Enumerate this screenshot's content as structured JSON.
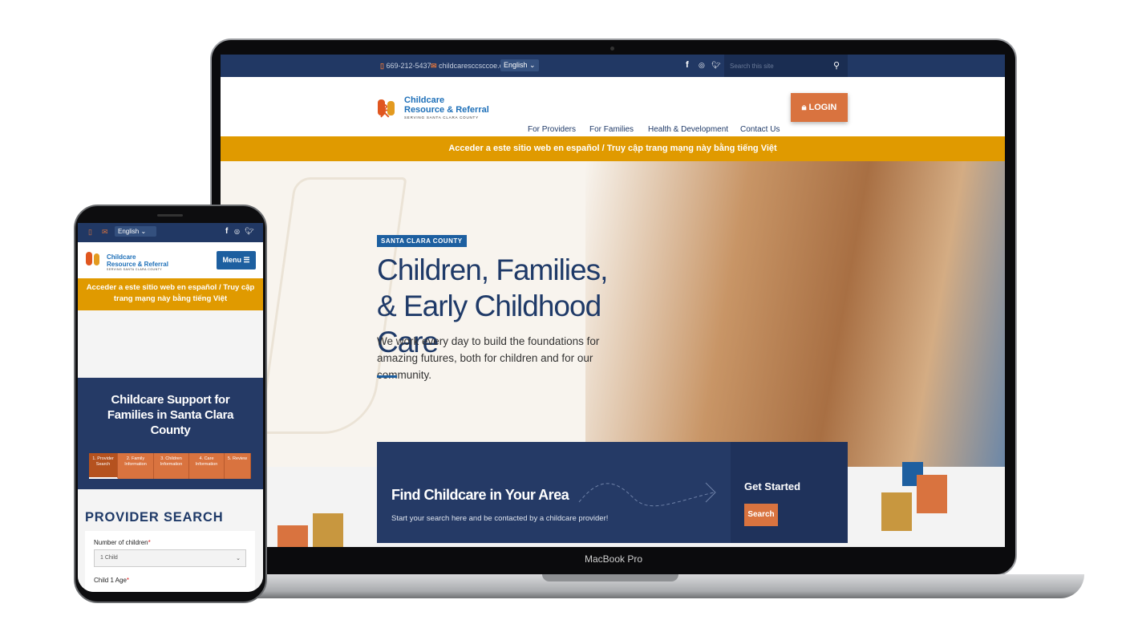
{
  "device_label": "MacBook Pro",
  "site": {
    "topbar": {
      "phone": "669-212-5437",
      "email": "childcaresccsccoe.org",
      "language": "English",
      "search_placeholder": "Search this site",
      "social": [
        "facebook-icon",
        "instagram-icon",
        "twitter-icon"
      ]
    },
    "logo": {
      "line1": "Childcare",
      "line2": "Resource & Referral",
      "tagline": "SERVING SANTA CLARA COUNTY"
    },
    "nav": [
      "For Providers",
      "For Families",
      "Health & Development",
      "Contact Us"
    ],
    "login_label": "LOGIN",
    "language_banner": "Acceder a este sitio web en español / Truy cập trang mạng này bằng tiếng Việt",
    "hero": {
      "badge": "SANTA CLARA COUNTY",
      "title": "Children, Families, & Early Childhood Care",
      "text": "We work every day to build the foundations for amazing futures, both for children and for our community."
    },
    "find": {
      "title": "Find Childcare in Your Area",
      "text": "Start your search here and be contacted by a childcare provider!",
      "cta_title": "Get Started",
      "button": "Search"
    }
  },
  "mobile": {
    "language": "English",
    "menu_label": "Menu",
    "title": "Childcare Support for Families in Santa Clara County",
    "steps": [
      "1. Provider Search",
      "2. Family Information",
      "3. Children Information",
      "4. Care Information",
      "5. Review"
    ],
    "active_step": 1,
    "section_title": "PROVIDER SEARCH",
    "field1_label": "Number of children",
    "field1_value": "1 Child",
    "field2_label": "Child 1 Age",
    "required_mark": "*"
  },
  "colors": {
    "navy": "#213864",
    "orange": "#d9733f",
    "gold": "#e09a00",
    "blue": "#1d5fa0"
  }
}
